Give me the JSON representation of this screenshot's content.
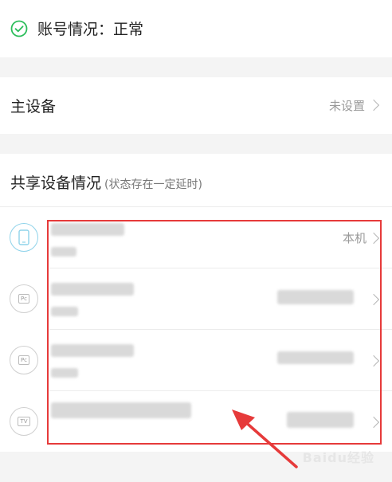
{
  "account": {
    "status_text": "账号情况：正常"
  },
  "main_device": {
    "title": "主设备",
    "value": "未设置"
  },
  "shared": {
    "title": "共享设备情况",
    "note": "(状态存在一定延时)",
    "devices": [
      {
        "icon": "phone-icon",
        "right_label": "本机"
      },
      {
        "icon": "pc-icon",
        "icon_text": "Pc",
        "right_label": ""
      },
      {
        "icon": "pc-icon",
        "icon_text": "Pc",
        "right_label": ""
      },
      {
        "icon": "tv-icon",
        "icon_text": "TV",
        "right_label": ""
      }
    ]
  },
  "watermark": "Baidu经验",
  "colors": {
    "accent_green": "#2bbd5a",
    "highlight_red": "#e63a3a",
    "phone_icon_blue": "#8fd3ea"
  }
}
